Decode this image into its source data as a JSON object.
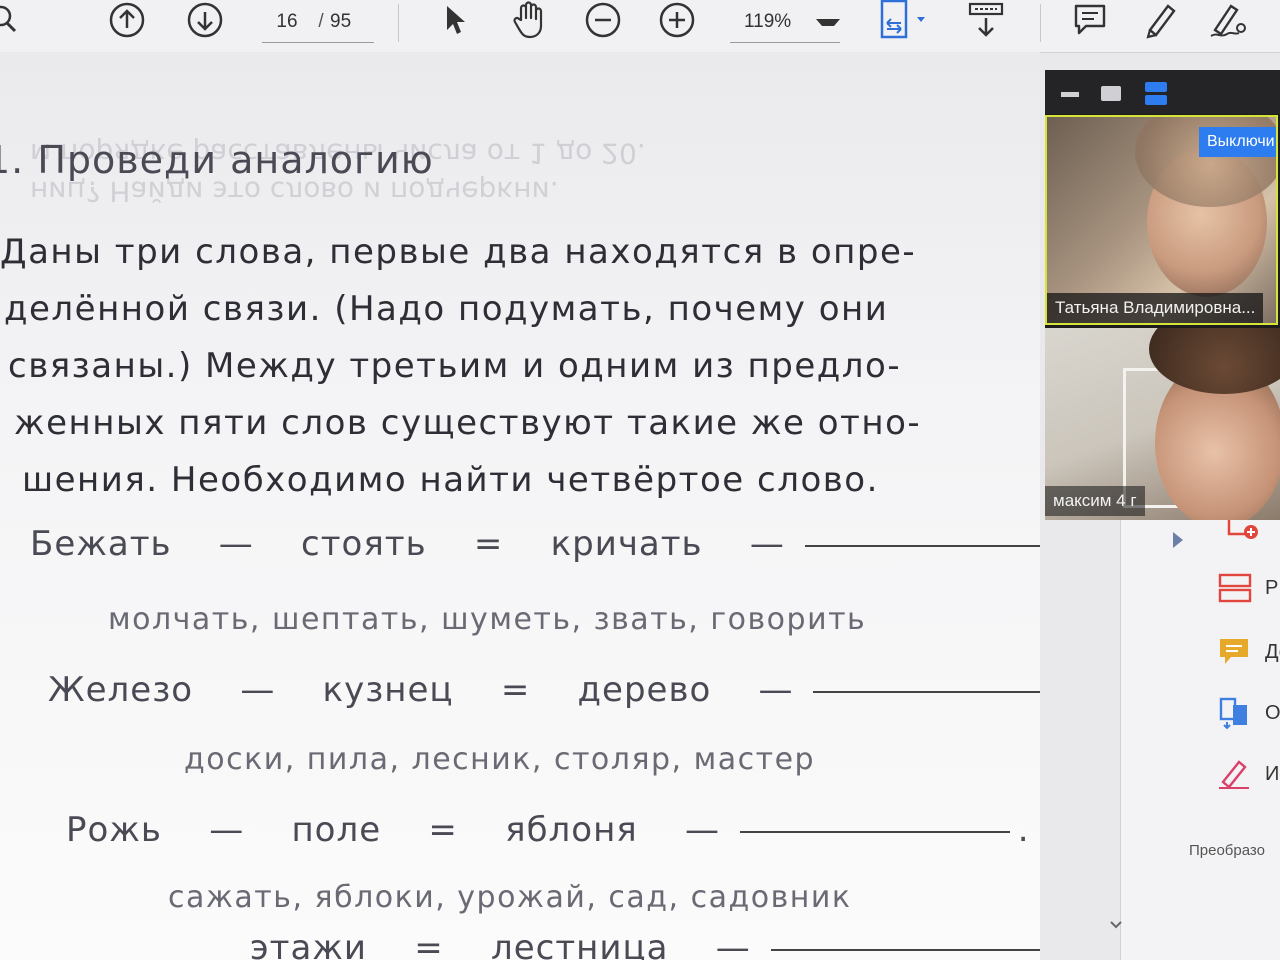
{
  "toolbar": {
    "current_page": "16",
    "separator": "/",
    "total_pages": "95",
    "zoom": "119%"
  },
  "document": {
    "ghost_lines": [
      "ниц? Найди это слово и подчеркни.",
      "м порядке расставлены числа от 1 до 20."
    ],
    "title": "1. Проведи  аналогию",
    "paragraph": [
      "Даны  три  слова,  первые  два  находятся  в  опре-",
      "делённой  связи.  (Надо  подумать,  почему  они",
      "связаны.)  Между  третьим  и  одним  из  предло-",
      "женных  пяти  слов  существуют  такие  же  отно-",
      "шения.  Необходимо  найти  четвёртое  слово."
    ],
    "tasks": [
      {
        "left": "Бежать",
        "dash1": "—",
        "mid": "стоять",
        "eq": "=",
        "right": "кричать",
        "dash2": "—",
        "end": ".",
        "options": "молчать,  шептать,  шуметь,  звать,  говорить"
      },
      {
        "left": "Железо",
        "dash1": "—",
        "mid": "кузнец",
        "eq": "=",
        "right": "дерево",
        "dash2": "—",
        "end": ".",
        "options": "доски,  пила,  лесник,  столяр,  мастер"
      },
      {
        "left": "Рожь",
        "dash1": "—",
        "mid": "поле",
        "eq": "=",
        "right": "яблоня",
        "dash2": "—",
        "end": ".",
        "options": "сажать,  яблоки,  урожай,  сад,  садовник"
      },
      {
        "left": "",
        "dash1": "",
        "mid": "этажи",
        "eq": "=",
        "right": "лестница",
        "dash2": "—",
        "end": ".",
        "options": ""
      }
    ]
  },
  "video": {
    "off_button": "Выключи",
    "participant1": "Татьяна Владимировна...",
    "participant2": "максим 4 г"
  },
  "tools": {
    "items": [
      "Р",
      "До",
      "Об",
      "Ис"
    ],
    "footer": "Преобразо"
  },
  "colors": {
    "accent_blue": "#2d7cf0",
    "active_speaker": "#d6e43a",
    "tool_red": "#e0463b",
    "tool_yellow": "#e7a92a",
    "tool_blue": "#3f7fe0",
    "tool_pink": "#d9406a"
  }
}
